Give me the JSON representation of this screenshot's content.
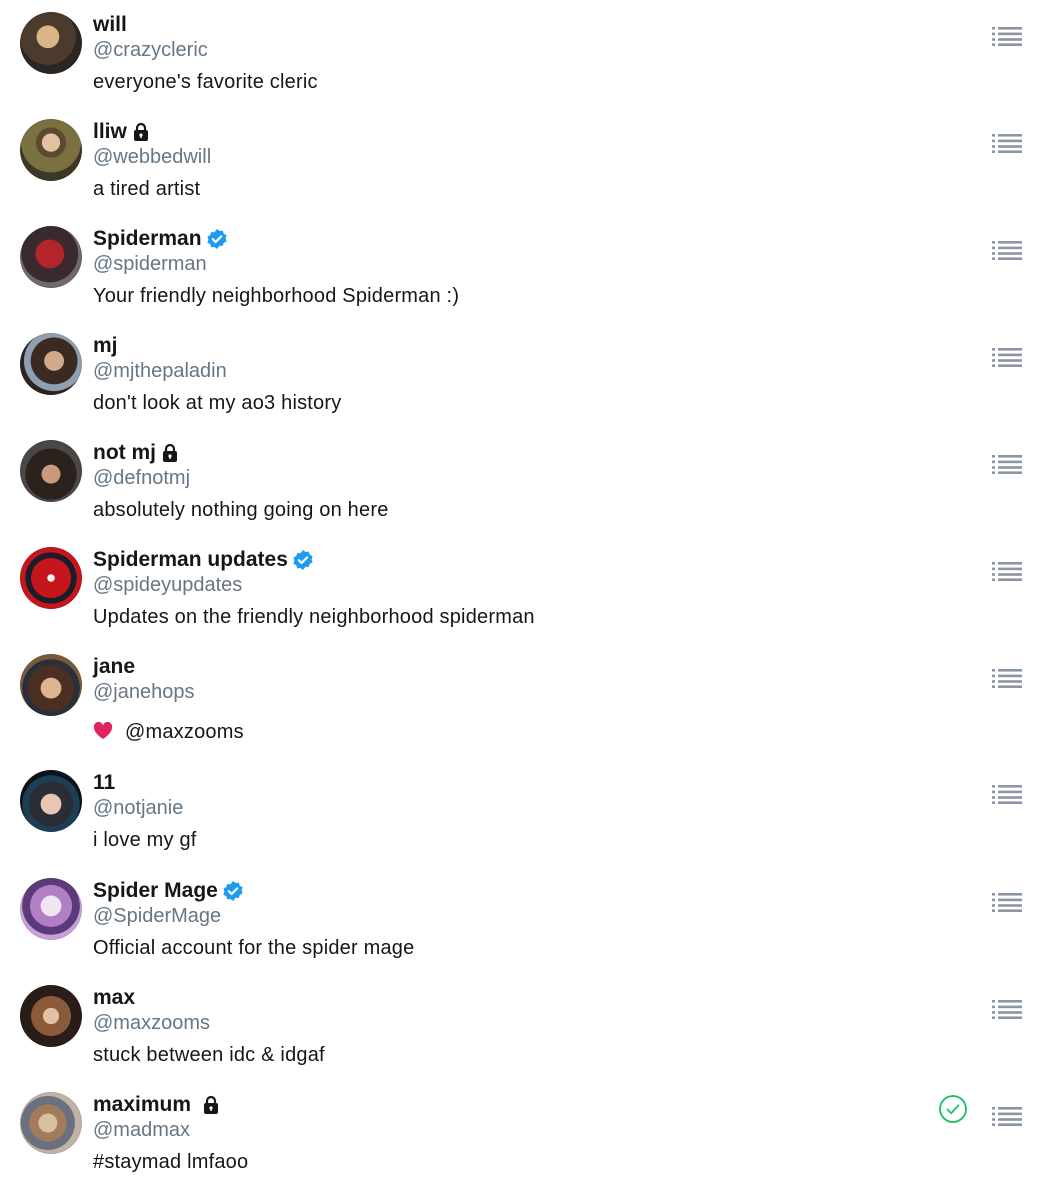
{
  "accounts": [
    {
      "name": "will",
      "handle": "@crazycleric",
      "bio": "everyone's favorite cleric",
      "verified": false,
      "locked": false
    },
    {
      "name": "lliw",
      "handle": "@webbedwill",
      "bio": "a tired artist",
      "verified": false,
      "locked": true
    },
    {
      "name": "Spiderman",
      "handle": "@spiderman",
      "bio": "Your friendly neighborhood Spiderman :)",
      "verified": true,
      "locked": false
    },
    {
      "name": "mj",
      "handle": "@mjthepaladin",
      "bio": "don't look at my ao3 history",
      "verified": false,
      "locked": false
    },
    {
      "name": "not mj",
      "handle": "@defnotmj",
      "bio": "absolutely nothing going on here",
      "verified": false,
      "locked": true
    },
    {
      "name": "Spiderman updates",
      "handle": "@spideyupdates",
      "bio": "Updates on the friendly neighborhood spiderman",
      "verified": true,
      "locked": false
    },
    {
      "name": "jane",
      "handle": "@janehops",
      "bio": "@maxzooms",
      "bio_emoji": "heart-icon",
      "verified": false,
      "locked": false
    },
    {
      "name": "11",
      "handle": "@notjanie",
      "bio": "i love my gf",
      "verified": false,
      "locked": false
    },
    {
      "name": "Spider Mage",
      "handle": "@SpiderMage",
      "bio": "Official account for the spider mage",
      "verified": true,
      "locked": false
    },
    {
      "name": "max",
      "handle": "@maxzooms",
      "bio": "stuck between idc & idgaf",
      "verified": false,
      "locked": false
    },
    {
      "name": "maximum",
      "handle": "@madmax",
      "bio": "#staymad lmfaoo",
      "verified": false,
      "locked": true,
      "selected": true
    }
  ],
  "colors": {
    "handle": "#657786",
    "verified": "#1d9bf0",
    "check": "#17bf63",
    "icon": "#8a96a3",
    "heart": "#e0245e"
  }
}
